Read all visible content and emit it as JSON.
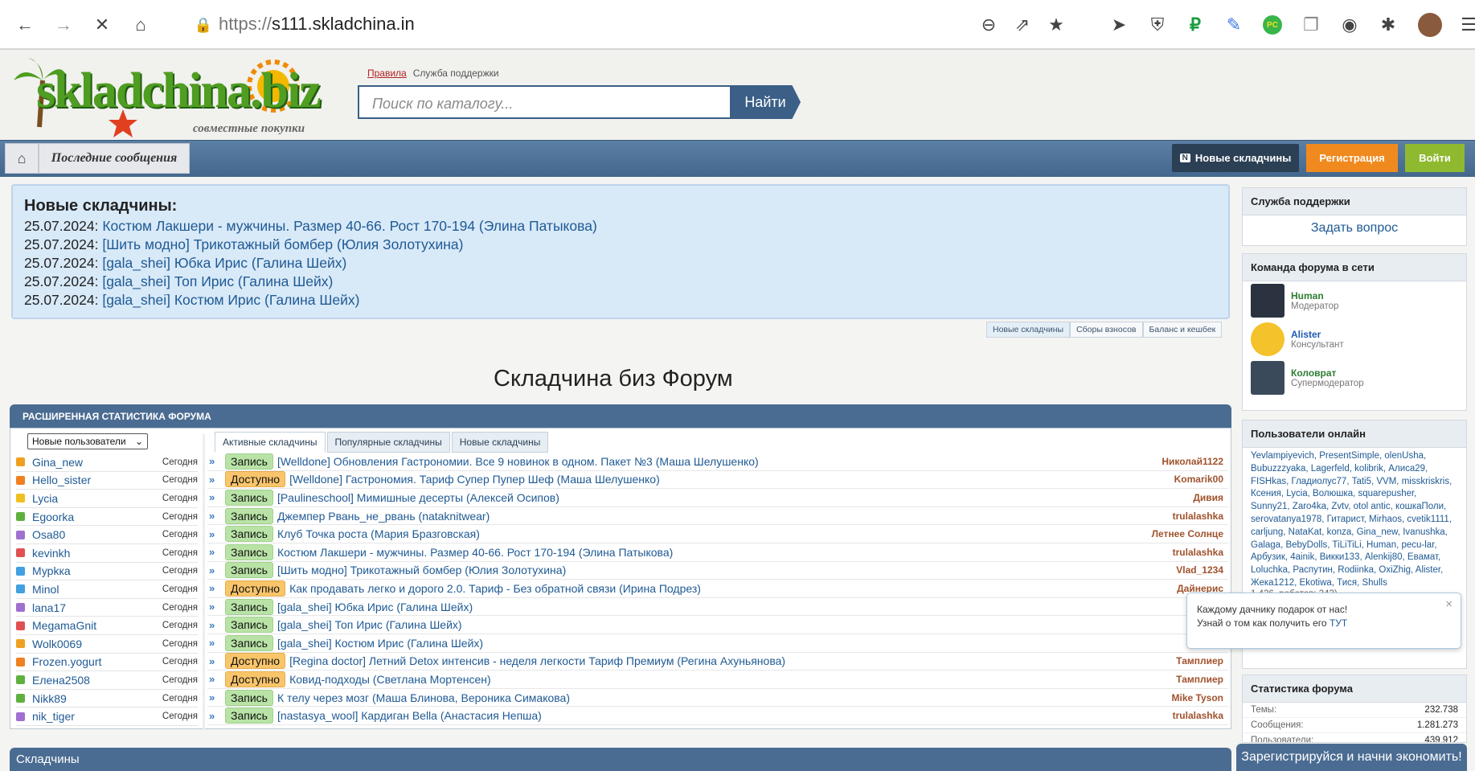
{
  "browser": {
    "url_scheme": "https://",
    "url_host": "s111.skladchina.in"
  },
  "header": {
    "logo_text": "skladchina.biz",
    "logo_sub": "совместные покупки",
    "link_rules": "Правила",
    "link_support": "Служба поддержки",
    "search_placeholder": "Поиск по каталогу...",
    "search_button": "Найти"
  },
  "nav": {
    "last_messages": "Последние сообщения",
    "new_skladchiny": "Новые складчины",
    "register": "Регистрация",
    "login": "Войти"
  },
  "notice": {
    "title": "Новые складчины:",
    "items": [
      {
        "date": "25.07.2024:",
        "text": "Костюм Лакшери - мужчины. Размер 40-66. Рост 170-194 (Элина Патыкова)"
      },
      {
        "date": "25.07.2024:",
        "text": "[Шить модно] Трикотажный бомбер (Юлия Золотухина)"
      },
      {
        "date": "25.07.2024:",
        "text": "[gala_shei] Юбка Ирис (Галина Шейх)"
      },
      {
        "date": "25.07.2024:",
        "text": "[gala_shei] Топ Ирис (Галина Шейх)"
      },
      {
        "date": "25.07.2024:",
        "text": "[gala_shei] Костюм Ирис (Галина Шейх)"
      }
    ],
    "tabs": [
      "Новые складчины",
      "Сборы взносов",
      "Баланс и кешбек"
    ]
  },
  "forum_title": "Складчина биз Форум",
  "stats": {
    "header": "РАСШИРЕННАЯ СТАТИСТИКА ФОРУМА",
    "select_value": "Новые пользователи",
    "tabs": [
      "Активные складчины",
      "Популярные складчины",
      "Новые складчины"
    ],
    "users": [
      {
        "name": "Gina_new",
        "date": "Сегодня",
        "color": "#f0a020"
      },
      {
        "name": "Hello_sister",
        "date": "Сегодня",
        "color": "#f08020"
      },
      {
        "name": "Lycia",
        "date": "Сегодня",
        "color": "#f0c020"
      },
      {
        "name": "Egoorka",
        "date": "Сегодня",
        "color": "#60b040"
      },
      {
        "name": "Osa80",
        "date": "Сегодня",
        "color": "#a070d0"
      },
      {
        "name": "kevinkh",
        "date": "Сегодня",
        "color": "#e05050"
      },
      {
        "name": "Мурkка",
        "date": "Сегодня",
        "color": "#40a0e0"
      },
      {
        "name": "Minol",
        "date": "Сегодня",
        "color": "#40a0e0"
      },
      {
        "name": "lana17",
        "date": "Сегодня",
        "color": "#a070d0"
      },
      {
        "name": "MegamaGnit",
        "date": "Сегодня",
        "color": "#e05050"
      },
      {
        "name": "Wolk0069",
        "date": "Сегодня",
        "color": "#f0a020"
      },
      {
        "name": "Frozen.yogurt",
        "date": "Сегодня",
        "color": "#f08020"
      },
      {
        "name": "Елена2508",
        "date": "Сегодня",
        "color": "#60b040"
      },
      {
        "name": "Nikk89",
        "date": "Сегодня",
        "color": "#60b040"
      },
      {
        "name": "nik_tiger",
        "date": "Сегодня",
        "color": "#a070d0"
      }
    ],
    "topics": [
      {
        "prefix": "Запись",
        "kind": "zap",
        "title": "[Welldone] Обновления Гастрономии. Все 9 новинок в одном. Пакет №3 (Маша Шелушенко)",
        "author": "Николай1122"
      },
      {
        "prefix": "Доступно",
        "kind": "dost",
        "title": "[Welldone] Гастрономия. Тариф Супер Пупер Шеф (Маша Шелушенко)",
        "author": "Komarik00"
      },
      {
        "prefix": "Запись",
        "kind": "zap",
        "title": "[Paulineschool] Мимишные десерты (Алексей Осипов)",
        "author": "Дивия"
      },
      {
        "prefix": "Запись",
        "kind": "zap",
        "title": "Джемпер Рвань_не_рвань (nataknitwear)",
        "author": "trulalashka"
      },
      {
        "prefix": "Запись",
        "kind": "zap",
        "title": "Клуб Точка роста (Мария Бразговская)",
        "author": "Летнее Солнце"
      },
      {
        "prefix": "Запись",
        "kind": "zap",
        "title": "Костюм Лакшери - мужчины. Размер 40-66. Рост 170-194 (Элина Патыкова)",
        "author": "trulalashka"
      },
      {
        "prefix": "Запись",
        "kind": "zap",
        "title": "[Шить модно] Трикотажный бомбер (Юлия Золотухина)",
        "author": "Vlad_1234"
      },
      {
        "prefix": "Доступно",
        "kind": "dost",
        "title": "Как продавать легко и дорого 2.0. Тариф - Без обратной связи (Ирина Подрез)",
        "author": "Дайнерис"
      },
      {
        "prefix": "Запись",
        "kind": "zap",
        "title": "[gala_shei] Юбка Ирис (Галина Шейх)",
        "author": "tru"
      },
      {
        "prefix": "Запись",
        "kind": "zap",
        "title": "[gala_shei] Топ Ирис (Галина Шейх)",
        "author": "tru"
      },
      {
        "prefix": "Запись",
        "kind": "zap",
        "title": "[gala_shei] Костюм Ирис (Галина Шейх)",
        "author": "tru"
      },
      {
        "prefix": "Доступно",
        "kind": "dost",
        "title": "[Regina doctor] Летний Detox интенсив - неделя легкости Тариф Премиум (Регина Ахуньянова)",
        "author": "Тамплиер"
      },
      {
        "prefix": "Доступно",
        "kind": "dost",
        "title": "Ковид-подходы (Светлана Мортенсен)",
        "author": "Тамплиер"
      },
      {
        "prefix": "Запись",
        "kind": "zap",
        "title": "К телу через мозг (Маша Блинова, Вероника Симакова)",
        "author": "Mike Tyson"
      },
      {
        "prefix": "Запись",
        "kind": "zap",
        "title": "[nastasya_wool] Кардиган Bella (Анастасия Непша)",
        "author": "trulalashka"
      }
    ]
  },
  "sidebar": {
    "support_title": "Служба поддержки",
    "support_link": "Задать вопрос",
    "team_title": "Команда форума в сети",
    "team": [
      {
        "name": "Human",
        "role": "Модератор",
        "color": "#2e7d32"
      },
      {
        "name": "Alister",
        "role": "Консультант",
        "color": "#1f5ab4"
      },
      {
        "name": "Коловрат",
        "role": "Супермодератор",
        "color": "#2e7d32"
      }
    ],
    "online_title": "Пользователи онлайн",
    "online_text": "Yevlampiyevich, PresentSimple, olenUsha, Bubuzzzyaka, Lagerfeld, kolibrik, Алиса29, FISHkas, Гладиолус77, Tati5, VVM, misskriskris, Ксения, Lycia, Волюшка, squarepusher, Sunny21, Zaro4ka, Zvtv, otol antic, кошкаПоли, serovatanya1978, Гитарист, Mirhaos, cvetik1111, carljung, NataKat, konza, Gina_new, Ivanushka, Galaga, BebyDolls, TiLiTiLi, Human, pecu-lar, Арбузик, 4ainik, Викки133, Alenkij80, Евамат, Loluchka, Распутин, Rodiinka, OxiZhig, Alister, Жека1212, Ekotiwa, Тися, Shulls",
    "online_tail": "1.426, роботов: 343)",
    "stats_title": "Статистика форума",
    "stats": [
      {
        "label": "Темы:",
        "value": "232.738"
      },
      {
        "label": "Сообщения:",
        "value": "1.281.273"
      },
      {
        "label": "Пользователи:",
        "value": "439.912"
      }
    ]
  },
  "popup": {
    "line1": "Каждому дачнику подарок от нас!",
    "line2": "Узнай о том как получить его",
    "link": "ТУТ",
    "close": "×"
  },
  "footer": {
    "section": "Складчины",
    "banner": "Зарегистрируйся и начни экономить!"
  }
}
